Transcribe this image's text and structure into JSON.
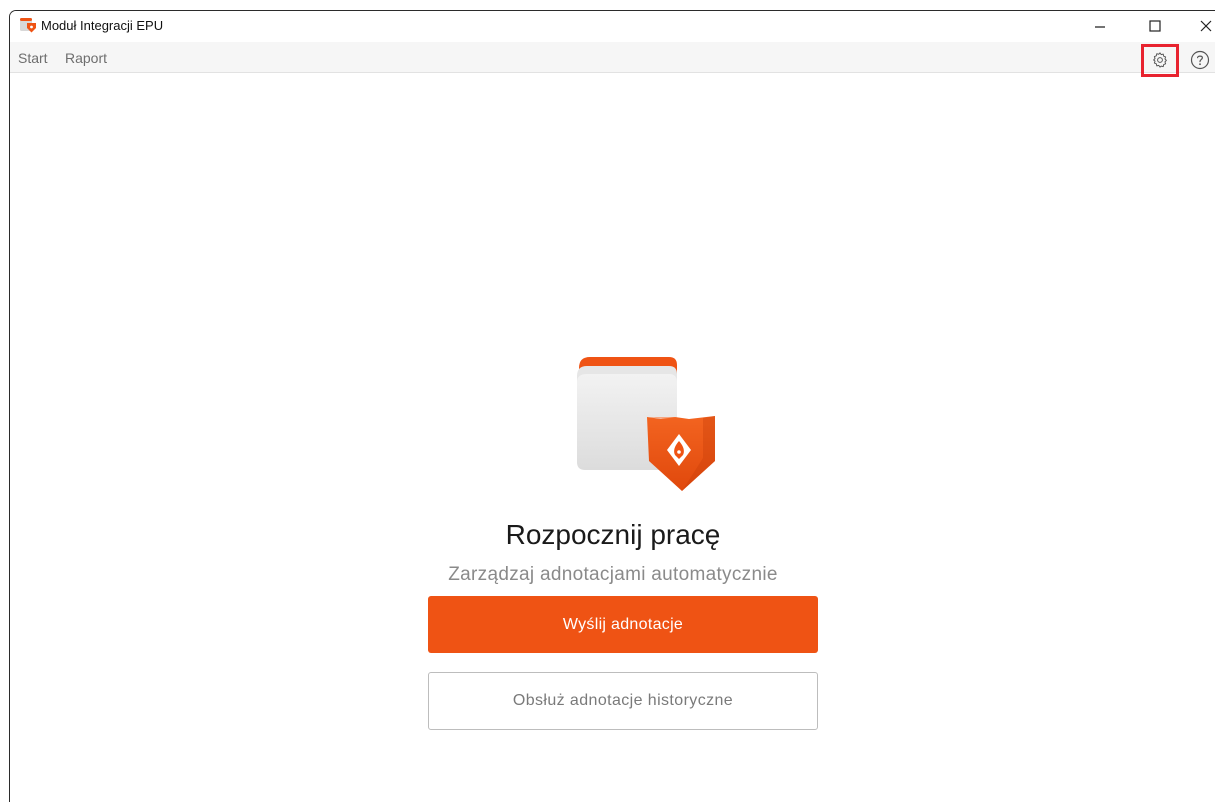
{
  "window": {
    "title": "Moduł Integracji EPU"
  },
  "menubar": {
    "items": [
      {
        "label": "Start"
      },
      {
        "label": "Raport"
      }
    ],
    "icons": [
      "settings-icon",
      "help-icon"
    ],
    "highlight_color": "#e8232f"
  },
  "main": {
    "heading": "Rozpocznij pracę",
    "subheading": "Zarządzaj adnotacjami automatycznie",
    "primary_button": "Wyślij adnotacje",
    "secondary_button": "Obsłuż adnotacje historyczne"
  },
  "colors": {
    "accent": "#ef5314",
    "accent_dark": "#d9480f"
  }
}
